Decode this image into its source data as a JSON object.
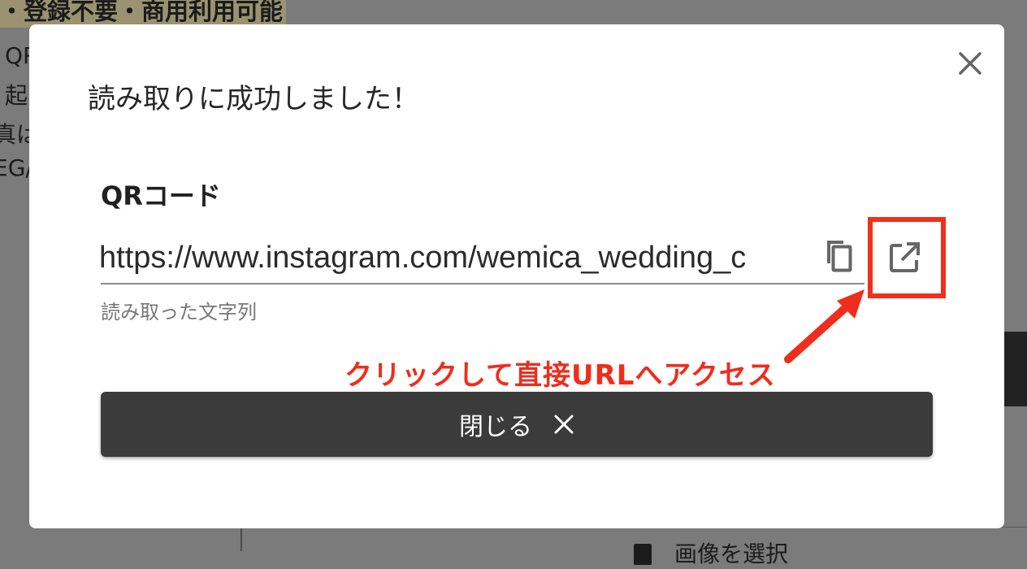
{
  "background": {
    "heading": "・登録不要・商用利用可能",
    "line1": "QR",
    "line2": "起",
    "line3": "真は",
    "line4": "EG/",
    "select_button": "画像を選択"
  },
  "modal": {
    "title": "読み取りに成功しました！",
    "field_label": "QRコード",
    "url_value": "https://www.instagram.com/wemica_wedding_c",
    "helper_text": "読み取った文字列",
    "close_button_label": "閉じる",
    "close_icon": "close-icon",
    "copy_icon": "copy-icon",
    "open_icon": "open-in-new-icon"
  },
  "annotation": {
    "text": "クリックして直接URLへアクセス",
    "color": "#ef2d1c"
  }
}
